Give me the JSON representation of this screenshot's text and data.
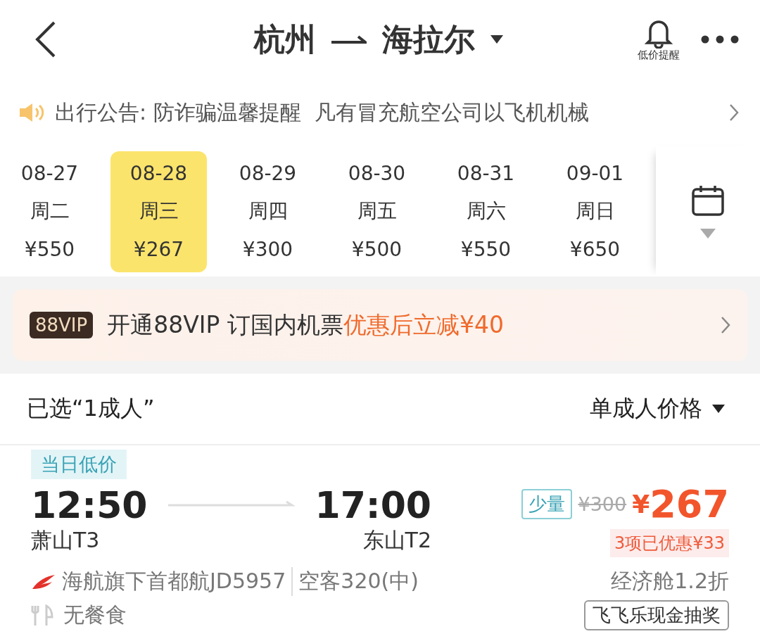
{
  "header": {
    "from": "杭州",
    "to": "海拉尔",
    "alert_label": "低价提醒"
  },
  "notice": {
    "label": "出行公告:",
    "text": "防诈骗温馨提醒  凡有冒充航空公司以飞机机械"
  },
  "dates": [
    {
      "date": "08-27",
      "weekday": "周二",
      "price": "¥550",
      "selected": false
    },
    {
      "date": "08-28",
      "weekday": "周三",
      "price": "¥267",
      "selected": true
    },
    {
      "date": "08-29",
      "weekday": "周四",
      "price": "¥300",
      "selected": false
    },
    {
      "date": "08-30",
      "weekday": "周五",
      "price": "¥500",
      "selected": false
    },
    {
      "date": "08-31",
      "weekday": "周六",
      "price": "¥550",
      "selected": false
    },
    {
      "date": "09-01",
      "weekday": "周日",
      "price": "¥650",
      "selected": false
    }
  ],
  "promo": {
    "badge": "88VIP",
    "text": "开通88VIP 订国内机票",
    "highlight": "优惠后立减¥40"
  },
  "passengers": {
    "selected_label": "已选“1成人”",
    "price_mode": "单成人价格"
  },
  "flight": {
    "tag": "当日低价",
    "depart_time": "12:50",
    "depart_airport": "萧山T3",
    "arrive_time": "17:00",
    "arrive_airport": "东山T2",
    "stock": "少量",
    "original_price": "¥300",
    "price_symbol": "¥",
    "price": "267",
    "discount": "3项已优惠¥33",
    "airline": "海航旗下首都航JD5957",
    "aircraft": "空客320(中)",
    "cabin": "经济舱1.2折",
    "meal": "无餐食",
    "promo_tag": "飞飞乐现金抽奖"
  }
}
